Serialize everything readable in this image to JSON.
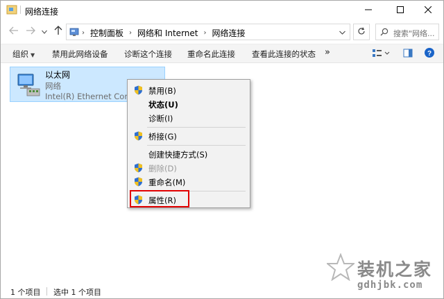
{
  "window": {
    "title": "网络连接",
    "icon": "network-connections-icon",
    "controls": [
      "minimize-icon",
      "maximize-icon",
      "close-icon"
    ]
  },
  "address": {
    "crumbs": [
      "控制面板",
      "网络和 Internet",
      "网络连接"
    ],
    "search_placeholder": "搜索\"网络..."
  },
  "commands": {
    "organize": "组织",
    "disable": "禁用此网络设备",
    "diagnose": "诊断这个连接",
    "rename": "重命名此连接",
    "view_status": "查看此连接的状态",
    "more": "»"
  },
  "network_item": {
    "name": "以太网",
    "status": "网络",
    "adapter": "Intel(R) Ethernet Connection"
  },
  "context_menu": {
    "items": [
      {
        "label": "禁用(B)",
        "icon": "shield-icon"
      },
      {
        "label": "状态(U)",
        "icon": ""
      },
      {
        "label": "诊断(I)",
        "icon": ""
      },
      {
        "label": "桥接(G)",
        "icon": "shield-icon"
      },
      {
        "label": "创建快捷方式(S)",
        "icon": ""
      },
      {
        "label": "删除(D)",
        "icon": "shield-icon"
      },
      {
        "label": "重命名(M)",
        "icon": "shield-icon"
      },
      {
        "label": "属性(R)",
        "icon": "shield-icon"
      }
    ],
    "highlight_color": "#e20000"
  },
  "statusbar": {
    "count": "1 个项目",
    "selected": "选中 1 个项目"
  },
  "watermark": {
    "title": "装机之家",
    "url": "gdhjbk.com"
  },
  "colors": {
    "selection": "#cce8ff",
    "accent": "#0078d7"
  }
}
